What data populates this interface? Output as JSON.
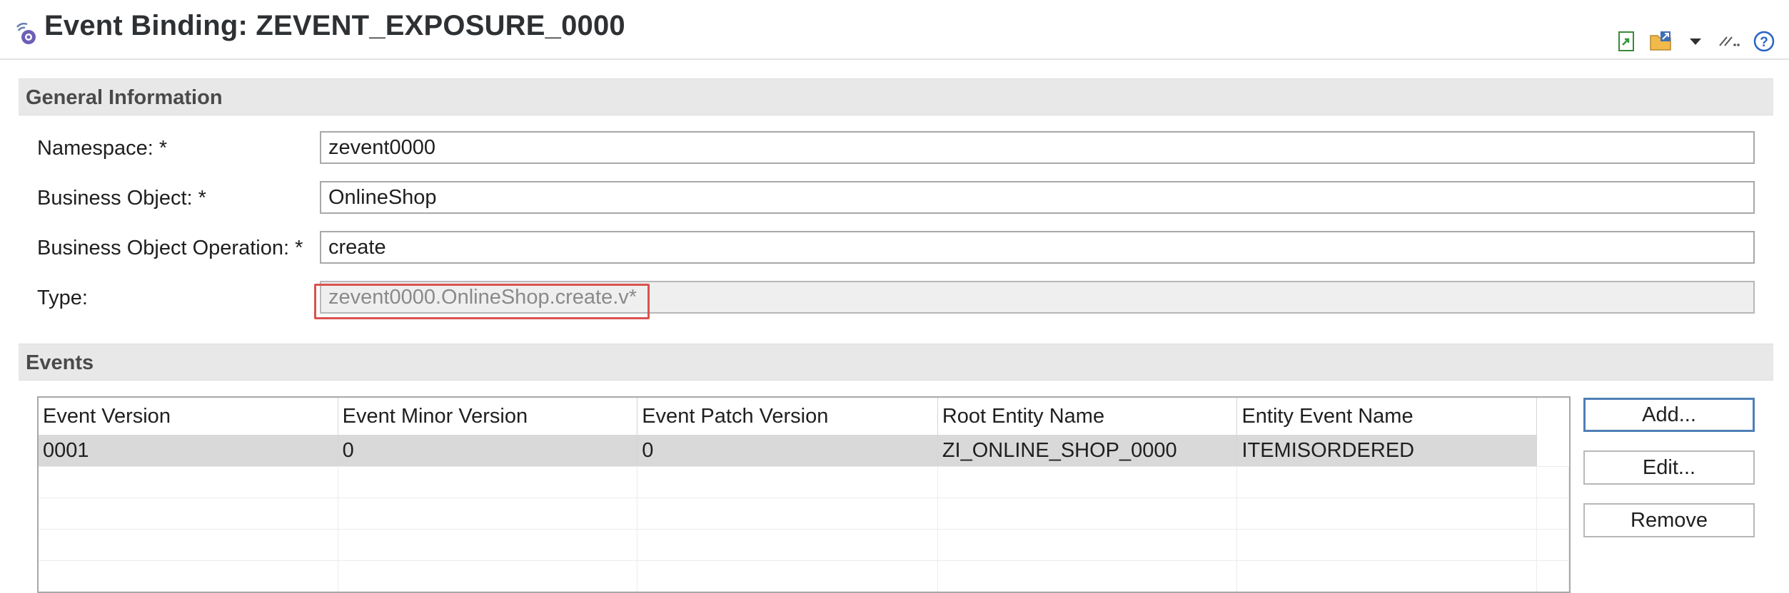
{
  "header": {
    "title": "Event Binding: ZEVENT_EXPOSURE_0000",
    "title_icon": "event-binding-icon",
    "toolbar_icons": [
      "export-icon",
      "folder-link-icon",
      "dropdown-arrow-icon",
      "link-icon",
      "help-icon"
    ]
  },
  "general": {
    "section_title": "General Information",
    "fields": [
      {
        "label": "Namespace: *",
        "value": "zevent0000"
      },
      {
        "label": "Business Object: *",
        "value": "OnlineShop"
      },
      {
        "label": "Business Object Operation: *",
        "value": "create"
      },
      {
        "label": "Type:",
        "value": "zevent0000.OnlineShop.create.v*"
      }
    ]
  },
  "events": {
    "section_title": "Events",
    "columns": [
      "Event Version",
      "Event Minor Version",
      "Event Patch Version",
      "Root Entity Name",
      "Entity Event Name"
    ],
    "rows": [
      [
        "0001",
        "0",
        "0",
        "ZI_ONLINE_SHOP_0000",
        "ITEMISORDERED"
      ]
    ],
    "buttons": {
      "add": "Add...",
      "edit": "Edit...",
      "remove": "Remove"
    }
  },
  "colors": {
    "highlight": "#d9534f",
    "section_bg": "#e8e8e8",
    "selected_row": "#d9d9d9"
  }
}
